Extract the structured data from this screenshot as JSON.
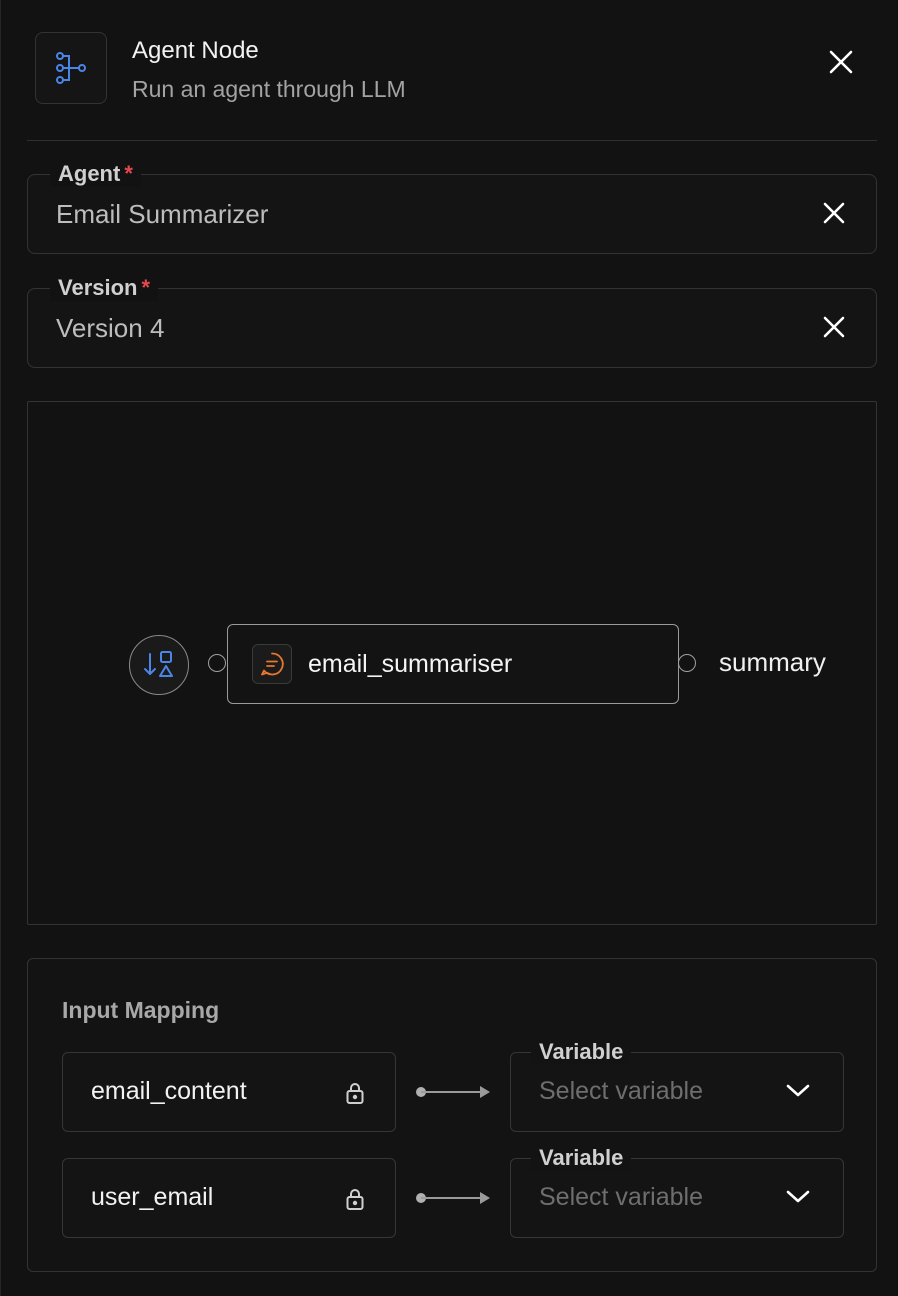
{
  "header": {
    "title": "Agent Node",
    "subtitle": "Run an agent through LLM",
    "icon": "workflow-icon",
    "close_icon": "close-icon"
  },
  "agent_field": {
    "label": "Agent",
    "required_mark": "*",
    "value": "Email Summarizer"
  },
  "version_field": {
    "label": "Version",
    "required_mark": "*",
    "value": "Version 4"
  },
  "canvas": {
    "start_node_icon": "sort-shapes-icon",
    "agent_node": {
      "label": "email_summariser",
      "icon": "chat-message-icon"
    },
    "output_label": "summary"
  },
  "input_mapping": {
    "title": "Input Mapping",
    "rows": [
      {
        "input": "email_content",
        "variable_label": "Variable",
        "placeholder": "Select variable"
      },
      {
        "input": "user_email",
        "variable_label": "Variable",
        "placeholder": "Select variable"
      }
    ]
  },
  "colors": {
    "accent_blue": "#4a86e8",
    "accent_orange": "#e8772e",
    "required_red": "#e5484d",
    "background": "#121212"
  }
}
